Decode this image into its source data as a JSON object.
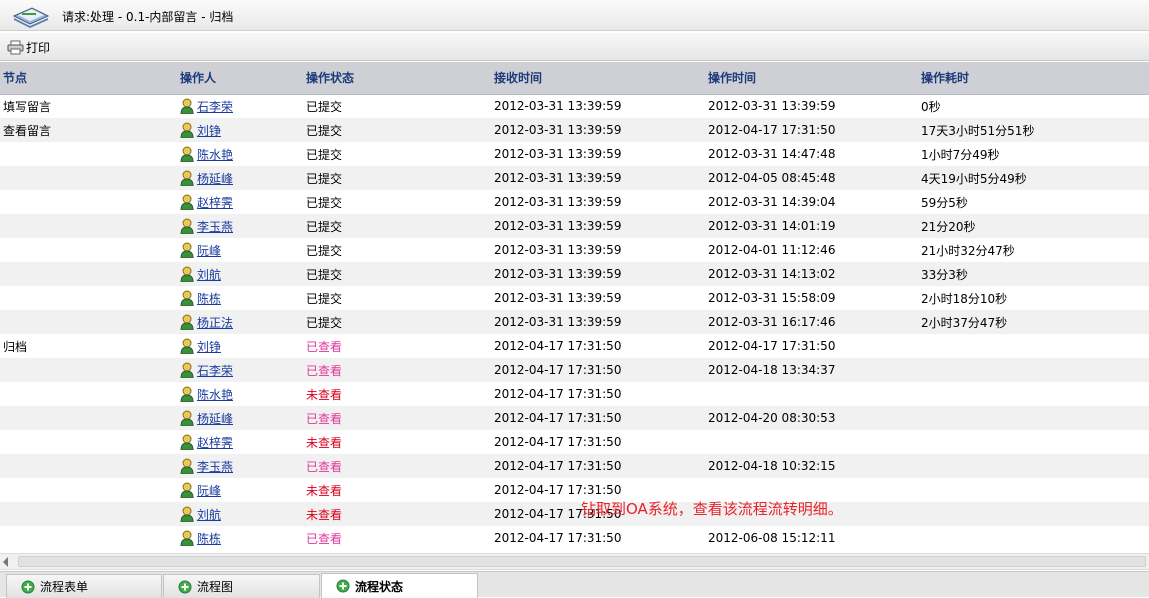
{
  "window": {
    "title": "请求:处理 - 0.1-内部留言 - 归档",
    "logo_icon": "document-stack-icon"
  },
  "toolbar": {
    "print_label": "打印",
    "print_icon": "printer-icon"
  },
  "table": {
    "columns": [
      "节点",
      "操作人",
      "操作状态",
      "接收时间",
      "操作时间",
      "操作耗时"
    ],
    "rows": [
      {
        "node": "填写留言",
        "user": "石李荣",
        "status": "已提交",
        "status_type": "submitted",
        "received": "2012-03-31 13:39:59",
        "operated": "2012-03-31 13:39:59",
        "duration": "0秒"
      },
      {
        "node": "查看留言",
        "user": "刘铮",
        "status": "已提交",
        "status_type": "submitted",
        "received": "2012-03-31 13:39:59",
        "operated": "2012-04-17 17:31:50",
        "duration": "17天3小时51分51秒"
      },
      {
        "node": "",
        "user": "陈水艳",
        "status": "已提交",
        "status_type": "submitted",
        "received": "2012-03-31 13:39:59",
        "operated": "2012-03-31 14:47:48",
        "duration": "1小时7分49秒"
      },
      {
        "node": "",
        "user": "杨延峰",
        "status": "已提交",
        "status_type": "submitted",
        "received": "2012-03-31 13:39:59",
        "operated": "2012-04-05 08:45:48",
        "duration": "4天19小时5分49秒"
      },
      {
        "node": "",
        "user": "赵梓霁",
        "status": "已提交",
        "status_type": "submitted",
        "received": "2012-03-31 13:39:59",
        "operated": "2012-03-31 14:39:04",
        "duration": "59分5秒"
      },
      {
        "node": "",
        "user": "李玉燕",
        "status": "已提交",
        "status_type": "submitted",
        "received": "2012-03-31 13:39:59",
        "operated": "2012-03-31 14:01:19",
        "duration": "21分20秒"
      },
      {
        "node": "",
        "user": "阮峰",
        "status": "已提交",
        "status_type": "submitted",
        "received": "2012-03-31 13:39:59",
        "operated": "2012-04-01 11:12:46",
        "duration": "21小时32分47秒"
      },
      {
        "node": "",
        "user": "刘航",
        "status": "已提交",
        "status_type": "submitted",
        "received": "2012-03-31 13:39:59",
        "operated": "2012-03-31 14:13:02",
        "duration": "33分3秒"
      },
      {
        "node": "",
        "user": "陈栋",
        "status": "已提交",
        "status_type": "submitted",
        "received": "2012-03-31 13:39:59",
        "operated": "2012-03-31 15:58:09",
        "duration": "2小时18分10秒"
      },
      {
        "node": "",
        "user": "杨正法",
        "status": "已提交",
        "status_type": "submitted",
        "received": "2012-03-31 13:39:59",
        "operated": "2012-03-31 16:17:46",
        "duration": "2小时37分47秒"
      },
      {
        "node": "归档",
        "user": "刘铮",
        "status": "已查看",
        "status_type": "viewed",
        "received": "2012-04-17 17:31:50",
        "operated": "2012-04-17 17:31:50",
        "duration": ""
      },
      {
        "node": "",
        "user": "石李荣",
        "status": "已查看",
        "status_type": "viewed",
        "received": "2012-04-17 17:31:50",
        "operated": "2012-04-18 13:34:37",
        "duration": ""
      },
      {
        "node": "",
        "user": "陈水艳",
        "status": "未查看",
        "status_type": "unviewed",
        "received": "2012-04-17 17:31:50",
        "operated": "",
        "duration": ""
      },
      {
        "node": "",
        "user": "杨延峰",
        "status": "已查看",
        "status_type": "viewed",
        "received": "2012-04-17 17:31:50",
        "operated": "2012-04-20 08:30:53",
        "duration": ""
      },
      {
        "node": "",
        "user": "赵梓霁",
        "status": "未查看",
        "status_type": "unviewed",
        "received": "2012-04-17 17:31:50",
        "operated": "",
        "duration": ""
      },
      {
        "node": "",
        "user": "李玉燕",
        "status": "已查看",
        "status_type": "viewed",
        "received": "2012-04-17 17:31:50",
        "operated": "2012-04-18 10:32:15",
        "duration": ""
      },
      {
        "node": "",
        "user": "阮峰",
        "status": "未查看",
        "status_type": "unviewed",
        "received": "2012-04-17 17:31:50",
        "operated": "",
        "duration": ""
      },
      {
        "node": "",
        "user": "刘航",
        "status": "未查看",
        "status_type": "unviewed",
        "received": "2012-04-17 17:31:50",
        "operated": "",
        "duration": ""
      },
      {
        "node": "",
        "user": "陈栋",
        "status": "已查看",
        "status_type": "viewed",
        "received": "2012-04-17 17:31:50",
        "operated": "2012-06-08 15:12:11",
        "duration": ""
      }
    ],
    "user_icon": "user-icon"
  },
  "colors": {
    "header_bg": "#cfd0d6",
    "header_text": "#1d3b7a",
    "link": "#1a3c9e",
    "viewed": "#e0379b",
    "unviewed": "#d9001b",
    "alt_row": "#f1f1f1"
  },
  "annotation": "钻取到OA系统，查看该流程流转明细。",
  "tabs": [
    {
      "label": "流程表单",
      "active": false
    },
    {
      "label": "流程图",
      "active": false
    },
    {
      "label": "流程状态",
      "active": true
    }
  ],
  "tab_icon": "plus-circle-icon"
}
